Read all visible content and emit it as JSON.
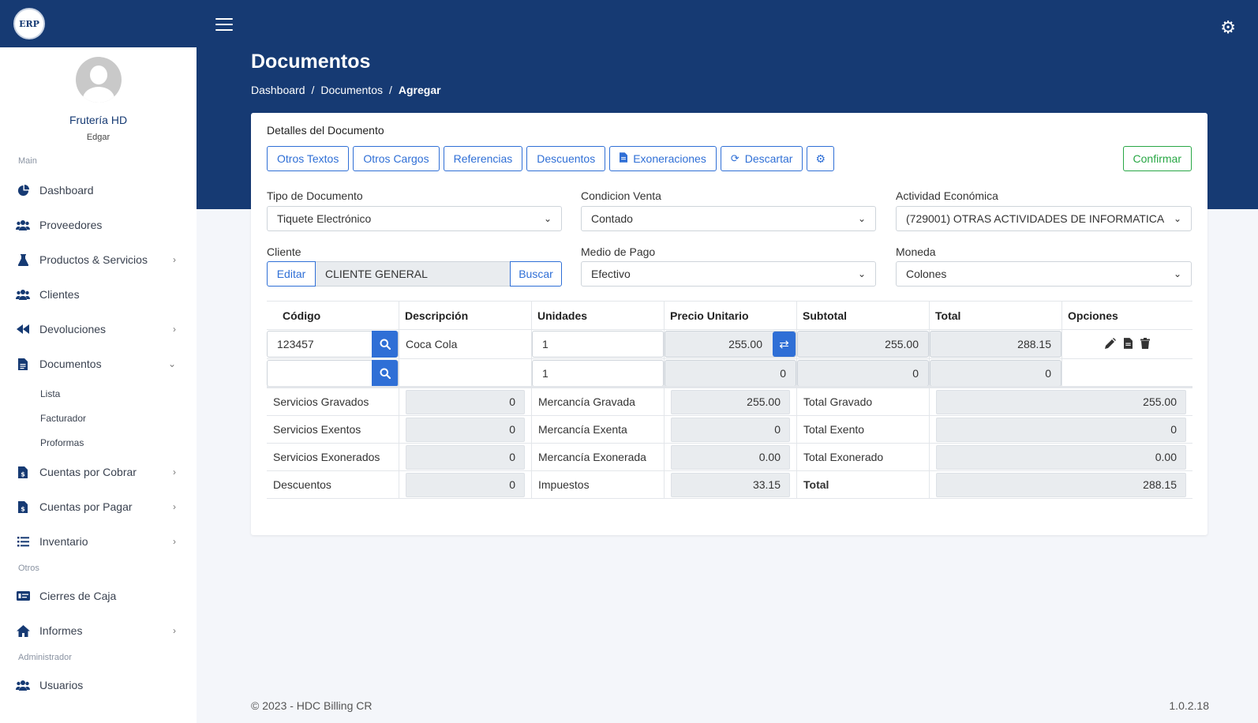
{
  "app": {
    "logo_text": "ERP"
  },
  "profile": {
    "name": "Frutería HD",
    "user": "Edgar"
  },
  "sidebar": {
    "section_main": "Main",
    "section_otros": "Otros",
    "section_admin": "Administrador",
    "items": [
      {
        "label": "Dashboard",
        "icon": "pie-chart-icon"
      },
      {
        "label": "Proveedores",
        "icon": "users-icon"
      },
      {
        "label": "Productos & Servicios",
        "icon": "flask-icon"
      },
      {
        "label": "Clientes",
        "icon": "users-icon"
      },
      {
        "label": "Devoluciones",
        "icon": "backward-icon"
      },
      {
        "label": "Documentos",
        "icon": "document-icon"
      },
      {
        "label": "Cuentas por Cobrar",
        "icon": "invoice-dollar-icon"
      },
      {
        "label": "Cuentas por Pagar",
        "icon": "invoice-dollar-icon"
      },
      {
        "label": "Inventario",
        "icon": "list-icon"
      },
      {
        "label": "Cierres de Caja",
        "icon": "money-check-icon"
      },
      {
        "label": "Informes",
        "icon": "home-icon"
      },
      {
        "label": "Usuarios",
        "icon": "users-icon"
      }
    ],
    "documentos_sub": [
      "Lista",
      "Facturador",
      "Proformas"
    ]
  },
  "header": {
    "title": "Documentos",
    "breadcrumb": [
      "Dashboard",
      "Documentos",
      "Agregar"
    ]
  },
  "card": {
    "title": "Detalles del Documento",
    "buttons": {
      "otros_textos": "Otros Textos",
      "otros_cargos": "Otros Cargos",
      "referencias": "Referencias",
      "descuentos": "Descuentos",
      "exoneraciones": "Exoneraciones",
      "descartar": "Descartar",
      "confirmar": "Confirmar"
    }
  },
  "form": {
    "tipo_documento": {
      "label": "Tipo de Documento",
      "value": "Tiquete Electrónico"
    },
    "condicion_venta": {
      "label": "Condicion Venta",
      "value": "Contado"
    },
    "actividad": {
      "label": "Actividad Económica",
      "value": "(729001) OTRAS ACTIVIDADES DE INFORMATICA"
    },
    "cliente": {
      "label": "Cliente",
      "edit": "Editar",
      "value": "CLIENTE GENERAL",
      "search": "Buscar"
    },
    "medio_pago": {
      "label": "Medio de Pago",
      "value": "Efectivo"
    },
    "moneda": {
      "label": "Moneda",
      "value": "Colones"
    }
  },
  "items_table": {
    "headers": [
      "Código",
      "Descripción",
      "Unidades",
      "Precio Unitario",
      "Subtotal",
      "Total",
      "Opciones"
    ],
    "rows": [
      {
        "codigo": "123457",
        "descripcion": "Coca Cola",
        "unidades": "1",
        "precio": "255.00",
        "subtotal": "255.00",
        "total": "288.15"
      },
      {
        "codigo": "",
        "descripcion": "",
        "unidades": "1",
        "precio": "0",
        "subtotal": "0",
        "total": "0"
      }
    ]
  },
  "totals": {
    "servicios_gravados": {
      "label": "Servicios Gravados",
      "value": "0"
    },
    "servicios_exentos": {
      "label": "Servicios Exentos",
      "value": "0"
    },
    "servicios_exonerados": {
      "label": "Servicios Exonerados",
      "value": "0"
    },
    "descuentos": {
      "label": "Descuentos",
      "value": "0"
    },
    "mercancia_gravada": {
      "label": "Mercancía Gravada",
      "value": "255.00"
    },
    "mercancia_exenta": {
      "label": "Mercancía Exenta",
      "value": "0"
    },
    "mercancia_exonerada": {
      "label": "Mercancía Exonerada",
      "value": "0.00"
    },
    "impuestos": {
      "label": "Impuestos",
      "value": "33.15"
    },
    "total_gravado": {
      "label": "Total Gravado",
      "value": "255.00"
    },
    "total_exento": {
      "label": "Total Exento",
      "value": "0"
    },
    "total_exonerado": {
      "label": "Total Exonerado",
      "value": "0.00"
    },
    "total": {
      "label": "Total",
      "value": "288.15"
    }
  },
  "footer": {
    "copyright": "© 2023 - HDC Billing CR",
    "version": "1.0.2.18"
  },
  "colors": {
    "brand": "#163a73",
    "primary": "#2f6fd6",
    "success": "#28a745"
  }
}
